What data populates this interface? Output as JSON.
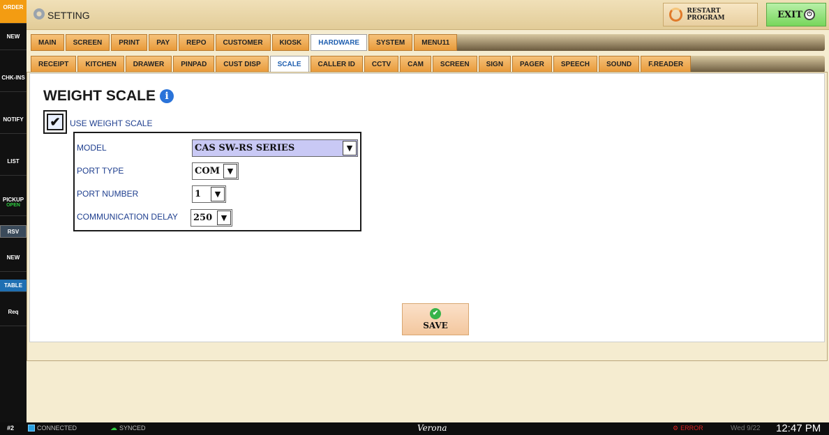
{
  "sidebar": {
    "items": [
      {
        "label": "ORDER",
        "sub": ""
      },
      {
        "label": "NEW",
        "sub": ""
      },
      {
        "label": "CHK-INS",
        "sub": ""
      },
      {
        "label": "NOTIFY",
        "sub": ""
      },
      {
        "label": "LIST",
        "sub": ""
      },
      {
        "label": "PICKUP",
        "sub": "OPEN"
      },
      {
        "label": "RSV",
        "sub": ""
      },
      {
        "label": "NEW",
        "sub": ""
      },
      {
        "label": "TABLE",
        "sub": ""
      },
      {
        "label": "Req",
        "sub": ""
      }
    ]
  },
  "titlebar": {
    "title": "SETTING",
    "restart_label": "RESTART PROGRAM",
    "exit_label": "EXIT"
  },
  "tabs_main": [
    "MAIN",
    "SCREEN",
    "PRINT",
    "PAY",
    "REPO",
    "CUSTOMER",
    "KIOSK",
    "HARDWARE",
    "SYSTEM",
    "MENU11"
  ],
  "tabs_main_active": "HARDWARE",
  "tabs_sub": [
    "RECEIPT",
    "KITCHEN",
    "DRAWER",
    "PINPAD",
    "CUST DISP",
    "SCALE",
    "CALLER ID",
    "CCTV",
    "CAM",
    "SCREEN",
    "SIGN",
    "PAGER",
    "SPEECH",
    "SOUND",
    "F.READER"
  ],
  "tabs_sub_active": "SCALE",
  "content": {
    "heading": "WEIGHT SCALE",
    "info_glyph": "i",
    "use_scale_label": "USE WEIGHT SCALE",
    "use_scale_checked": true,
    "fields": {
      "model": {
        "label": "MODEL",
        "value": "CAS SW-RS SERIES"
      },
      "port_type": {
        "label": "PORT TYPE",
        "value": "COM"
      },
      "port_number": {
        "label": "PORT NUMBER",
        "value": "1"
      },
      "comm_delay": {
        "label": "COMMUNICATION DELAY",
        "value": "250"
      }
    },
    "save_label": "SAVE"
  },
  "statusbar": {
    "station": "#2",
    "connection": "CONNECTED",
    "sync": "SYNCED",
    "store": "Verona",
    "error": "ERROR",
    "date": "Wed 9/22",
    "time": "12:47 PM"
  },
  "colors": {
    "tab": "#e89a3a",
    "tab_active_text": "#1f5fb0",
    "label_text": "#1f3f8f",
    "save_icon": "#37b34a",
    "exit_button": "#77d65b",
    "order_badge": "#f39c12"
  }
}
